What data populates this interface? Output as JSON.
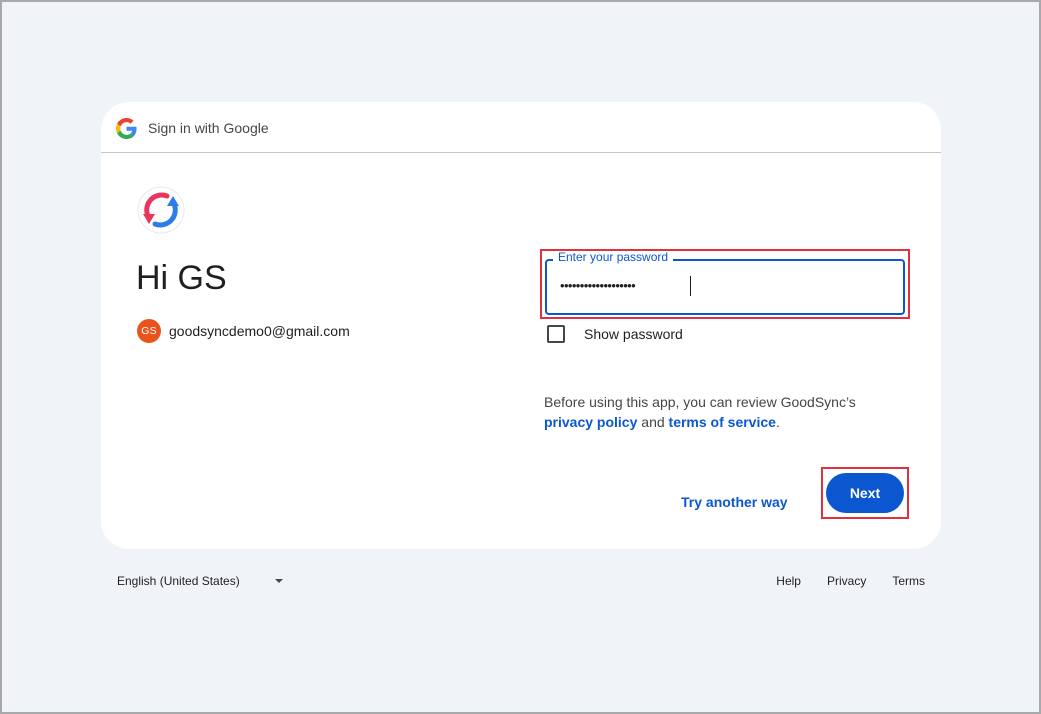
{
  "header": {
    "title": "Sign in with Google"
  },
  "main": {
    "greeting": "Hi GS",
    "account": {
      "avatar_initials": "GS",
      "email": "goodsyncdemo0@gmail.com"
    },
    "password": {
      "label": "Enter your password",
      "masked_value": "•••••••••••••••••••"
    },
    "show_password_label": "Show password",
    "review": {
      "prefix": "Before using this app, you can review GoodSync’s",
      "privacy_link": "privacy policy",
      "and": "and",
      "terms_link": "terms of service",
      "suffix": "."
    },
    "try_another_way": "Try another way",
    "next_label": "Next"
  },
  "footer": {
    "language": "English (United States)",
    "links": [
      "Help",
      "Privacy",
      "Terms"
    ]
  },
  "colors": {
    "accent": "#0b57d0",
    "page_background": "#f0f4f9",
    "highlight": "#e0323c",
    "avatar": "#e8541c"
  },
  "icons": {
    "header_logo": "google-g-icon",
    "app_logo": "goodsync-sync-icon",
    "language_dropdown": "caret-down-icon"
  }
}
